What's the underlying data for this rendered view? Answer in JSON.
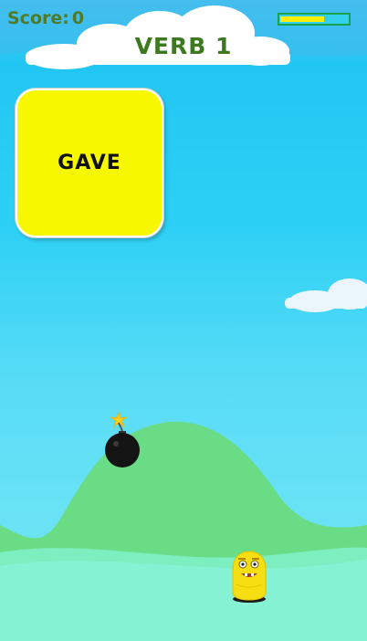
{
  "hud": {
    "score_label": "Score:",
    "score_value": "0",
    "energy_fraction": 0.65
  },
  "title": "VERB 1",
  "word_card": {
    "word": "GAVE"
  },
  "colors": {
    "card": "#f7f700",
    "hill": "#6ddc86",
    "title": "#3d7a1f",
    "score": "#4f7a2a"
  },
  "icons": {
    "bomb": "bomb-icon",
    "player": "yellow-blob-character"
  }
}
